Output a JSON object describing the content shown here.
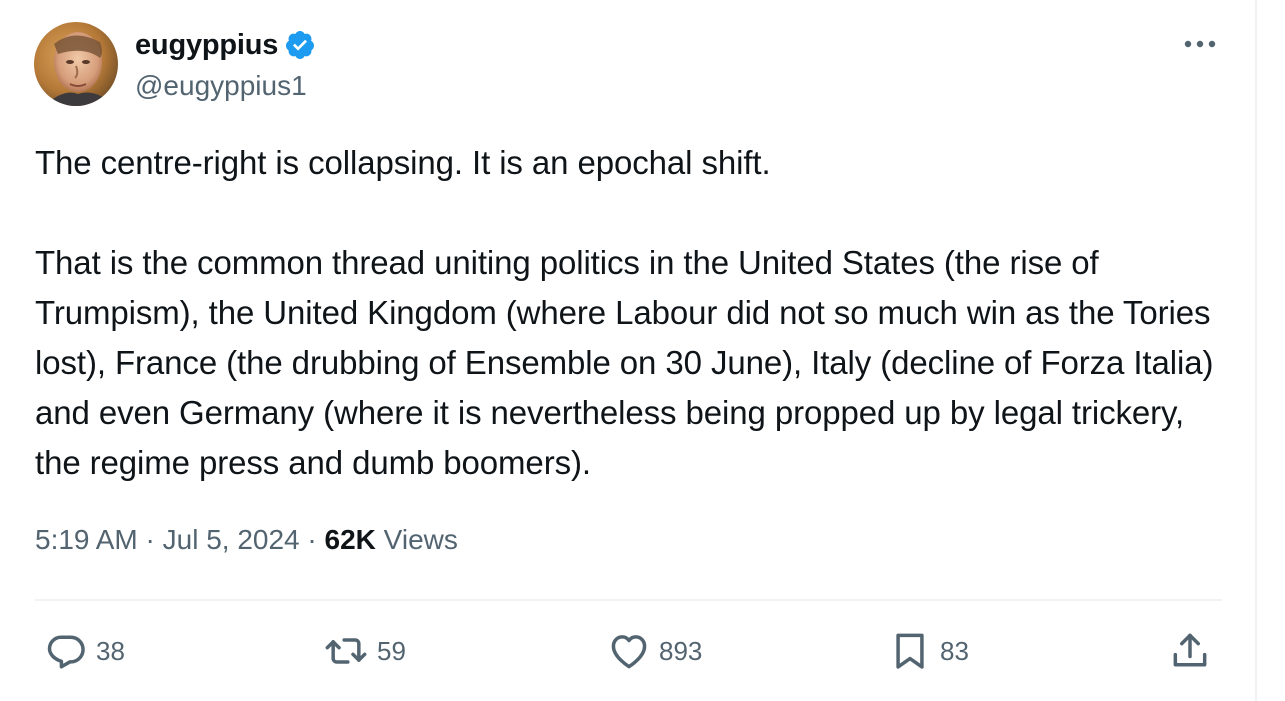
{
  "user": {
    "display_name": "eugyppius",
    "handle": "@eugyppius1"
  },
  "tweet": {
    "paragraphs": [
      "The centre-right is collapsing. It is an epochal shift.",
      "That is the common thread uniting politics in the United States (the rise of Trumpism), the United Kingdom (where Labour did not so much win as the Tories lost), France (the drubbing of Ensemble on 30 June), Italy (decline of Forza Italia) and even Germany (where it is nevertheless being propped up by legal trickery, the regime press and dumb boomers)."
    ],
    "time": "5:19 AM",
    "separator": "·",
    "date": "Jul 5, 2024",
    "views_count": "62K",
    "views_label": "Views"
  },
  "actions": {
    "replies": "38",
    "reposts": "59",
    "likes": "893",
    "bookmarks": "83"
  },
  "icons": {
    "verified": "verified-badge-icon",
    "more": "more-options-icon",
    "reply": "reply-icon",
    "repost": "repost-icon",
    "like": "like-icon",
    "bookmark": "bookmark-icon",
    "share": "share-icon"
  },
  "colors": {
    "text_primary": "#0f1419",
    "text_secondary": "#536471",
    "verified_blue": "#1d9bf0",
    "divider": "#eff3f4"
  }
}
